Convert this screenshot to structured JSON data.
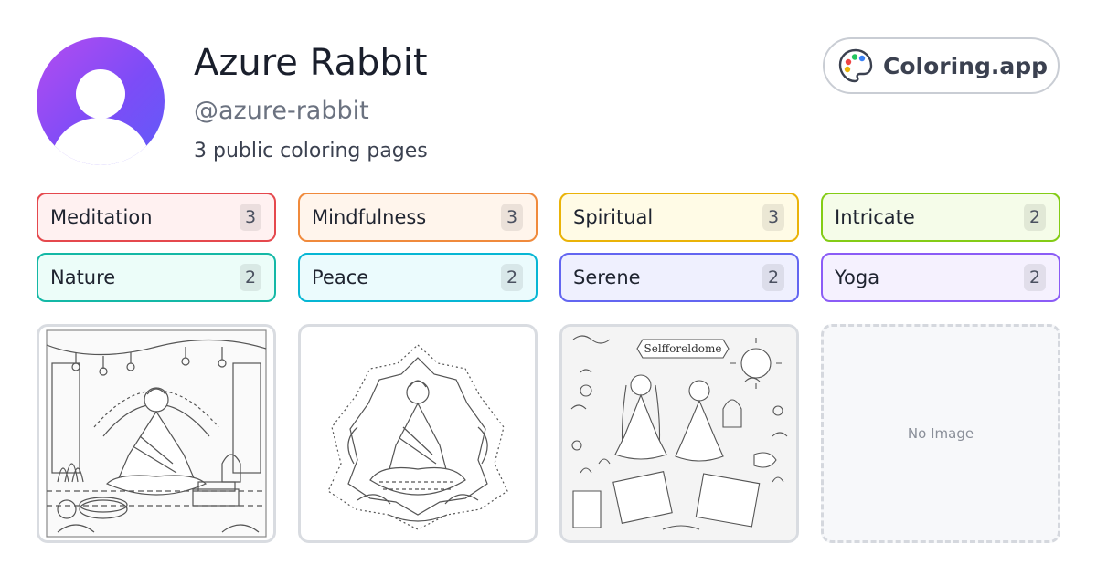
{
  "profile": {
    "name": "Azure Rabbit",
    "handle": "@azure-rabbit",
    "page_count_text": "3 public coloring pages"
  },
  "brand": {
    "label": "Coloring.app",
    "icon": "palette-icon"
  },
  "tags": [
    {
      "label": "Meditation",
      "count": "3",
      "border": "#e5484d",
      "bg": "#fff1f1"
    },
    {
      "label": "Mindfulness",
      "count": "3",
      "border": "#f08a3c",
      "bg": "#fff5ec"
    },
    {
      "label": "Spiritual",
      "count": "3",
      "border": "#eab308",
      "bg": "#fffbe6"
    },
    {
      "label": "Intricate",
      "count": "2",
      "border": "#84cc16",
      "bg": "#f5fce9"
    },
    {
      "label": "Nature",
      "count": "2",
      "border": "#14b8a6",
      "bg": "#ecfdf9"
    },
    {
      "label": "Peace",
      "count": "2",
      "border": "#06b6d4",
      "bg": "#ebfbfd"
    },
    {
      "label": "Serene",
      "count": "2",
      "border": "#6366f1",
      "bg": "#eff0fe"
    },
    {
      "label": "Yoga",
      "count": "2",
      "border": "#8b5cf6",
      "bg": "#f5f1fe"
    }
  ],
  "cards": [
    {
      "type": "image",
      "subject": "meditating-woman-room-illustration"
    },
    {
      "type": "image",
      "subject": "meditating-woman-mandala-illustration"
    },
    {
      "type": "image",
      "subject": "meditating-couple-doodle-illustration",
      "banner_text": "Selfforeldome"
    },
    {
      "type": "empty",
      "label": "No Image"
    }
  ]
}
